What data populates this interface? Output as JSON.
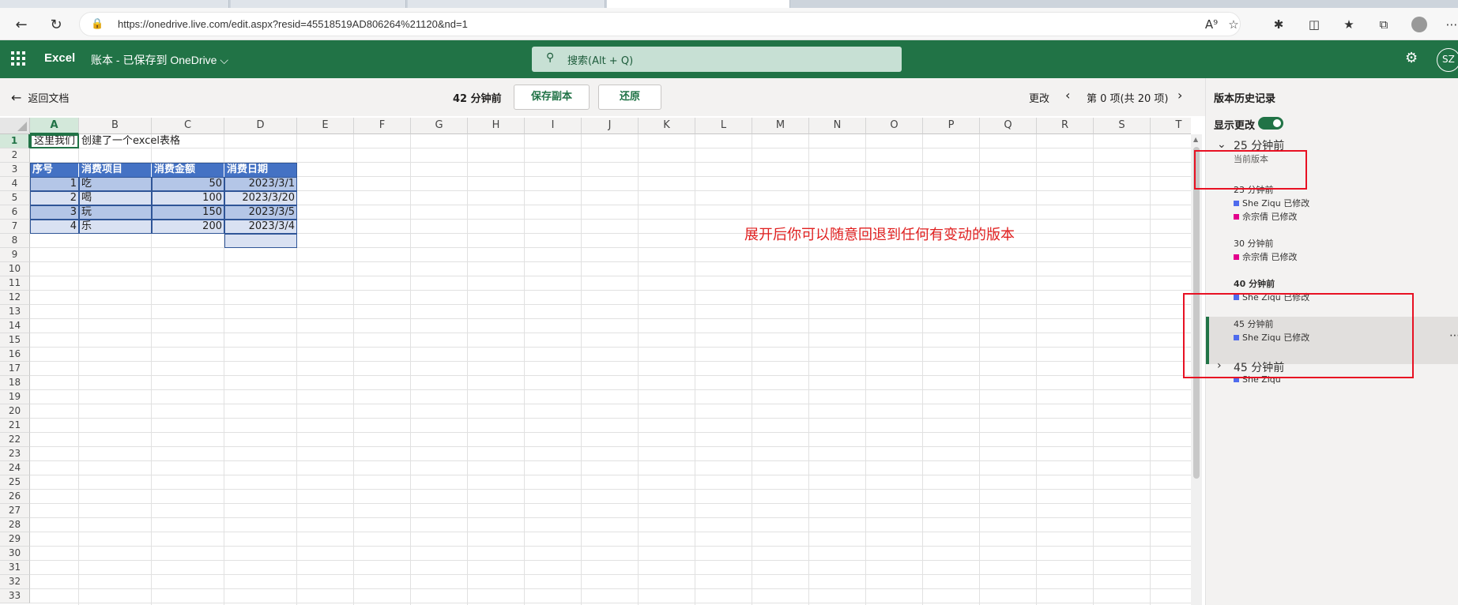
{
  "browser": {
    "url": "https://onedrive.live.com/edit.aspx?resid=45518519AD806264%21120&nd=1"
  },
  "app": {
    "name": "Excel",
    "doc_title": "账本  -  已保存到 OneDrive ⌵",
    "search_placeholder": "搜索(Alt + Q)",
    "user_initials": "SZ"
  },
  "toolbar": {
    "back_label": "返回文档",
    "time_ago": "42 分钟前",
    "save_copy_label": "保存副本",
    "restore_label": "还原",
    "changes_label": "更改",
    "change_count": "第 0 项(共 20 项)"
  },
  "sheet": {
    "columns": [
      "A",
      "B",
      "C",
      "D",
      "E",
      "F",
      "G",
      "H",
      "I",
      "J",
      "K",
      "L",
      "M",
      "N",
      "O",
      "P",
      "Q",
      "R",
      "S",
      "T"
    ],
    "rows": [
      "1",
      "2",
      "3",
      "4",
      "5",
      "6",
      "7",
      "8",
      "9",
      "10",
      "11",
      "12",
      "13",
      "14",
      "15",
      "16",
      "17",
      "18",
      "19",
      "20",
      "21",
      "22",
      "23",
      "24",
      "25",
      "26",
      "27",
      "28",
      "29",
      "30",
      "31",
      "32",
      "33"
    ],
    "a1_text": "这里我们",
    "a1_overflow": "创建了一个excel表格",
    "table_headers": [
      "序号",
      "消费项目",
      "消费金额",
      "消费日期"
    ],
    "table_rows": [
      [
        "1",
        "吃",
        "50",
        "2023/3/1"
      ],
      [
        "2",
        "喝",
        "100",
        "2023/3/20"
      ],
      [
        "3",
        "玩",
        "150",
        "2023/3/5"
      ],
      [
        "4",
        "乐",
        "200",
        "2023/3/4"
      ]
    ],
    "annotation": "展开后你可以随意回退到任何有变动的版本"
  },
  "panel": {
    "title": "版本历史记录",
    "show_changes_label": "显示更改",
    "show_changes_on": true,
    "group1_time": "25 分钟前",
    "current_version_label": "当前版本",
    "v23_time": "23 分钟前",
    "v23_author1": "She Ziqu 已修改",
    "v23_author2": "佘宗倩 已修改",
    "v30_time": "30 分钟前",
    "v30_author": "佘宗倩 已修改",
    "v40_time": "40 分钟前",
    "v40_author": "She Ziqu 已修改",
    "v45_time": "45 分钟前",
    "v45_author": "She Ziqu 已修改",
    "group2_time": "45 分钟前",
    "group2_author": "She Ziqu"
  },
  "colors": {
    "excel_green": "#217346",
    "table_header_blue": "#4472c4",
    "author_she_ziqu": "#4f6bed",
    "author_shezongqian": "#e3008c",
    "annotation_red": "#e02020"
  }
}
